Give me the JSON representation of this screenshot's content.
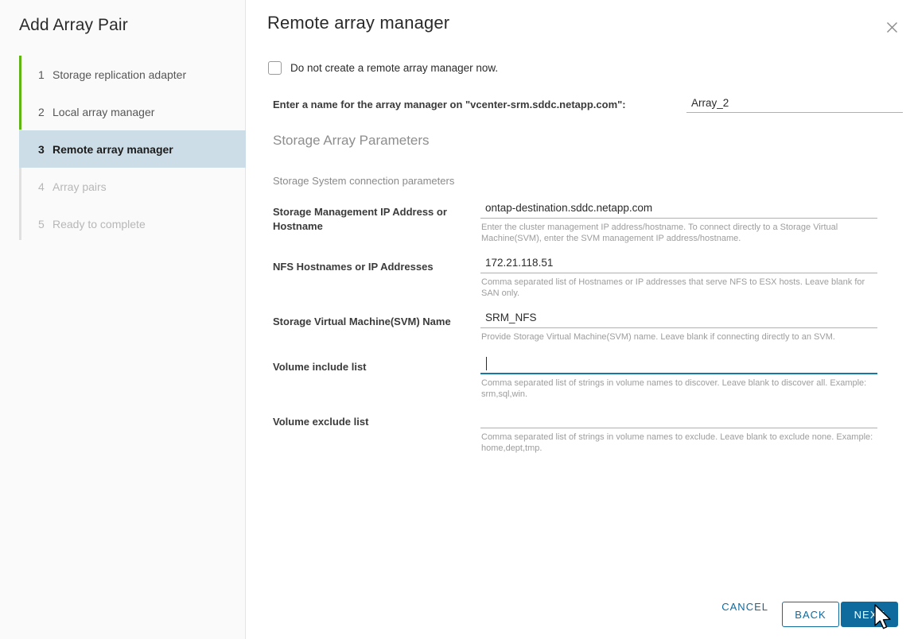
{
  "wizard": {
    "title": "Add Array Pair",
    "steps": [
      {
        "num": "1",
        "label": "Storage replication adapter",
        "state": "done"
      },
      {
        "num": "2",
        "label": "Local array manager",
        "state": "done"
      },
      {
        "num": "3",
        "label": "Remote array manager",
        "state": "active"
      },
      {
        "num": "4",
        "label": "Array pairs",
        "state": "disabled"
      },
      {
        "num": "5",
        "label": "Ready to complete",
        "state": "disabled"
      }
    ]
  },
  "panel": {
    "title": "Remote array manager",
    "close_icon": "close-icon"
  },
  "skip_checkbox": {
    "label": "Do not create a remote array manager now.",
    "checked": false
  },
  "array_name": {
    "label": "Enter a name for the array manager on \"vcenter-srm.sddc.netapp.com\":",
    "value": "Array_2",
    "placeholder": ""
  },
  "section": {
    "heading": "Storage Array Parameters",
    "subheading": "Storage System connection parameters"
  },
  "fields": [
    {
      "label": "Storage Management IP Address or Hostname",
      "value": "ontap-destination.sddc.netapp.com",
      "help": "Enter the cluster management IP address/hostname. To connect directly to a Storage Virtual Machine(SVM), enter the SVM management IP address/hostname.",
      "focused": false
    },
    {
      "label": "NFS Hostnames or IP Addresses",
      "value": "172.21.118.51",
      "help": "Comma separated list of Hostnames or IP addresses that serve NFS to ESX hosts. Leave blank for SAN only.",
      "focused": false
    },
    {
      "label": "Storage Virtual Machine(SVM) Name",
      "value": "SRM_NFS",
      "help": "Provide Storage Virtual Machine(SVM) name. Leave blank if connecting directly to an SVM.",
      "focused": false
    },
    {
      "label": "Volume include list",
      "value": "",
      "help": "Comma separated list of strings in volume names to discover. Leave blank to discover all. Example: srm,sql,win.",
      "focused": true
    },
    {
      "label": "Volume exclude list",
      "value": "",
      "help": "Comma separated list of strings in volume names to exclude. Leave blank to exclude none. Example: home,dept,tmp.",
      "focused": false
    }
  ],
  "footer": {
    "cancel_label": "CANCEL",
    "back_label": "BACK",
    "next_label": "NEXT"
  },
  "colors": {
    "accent_blue": "#0f6a9e",
    "focus_blue": "#157aa3",
    "progress_green": "#60b515",
    "active_step_bg": "#ccdde7"
  }
}
